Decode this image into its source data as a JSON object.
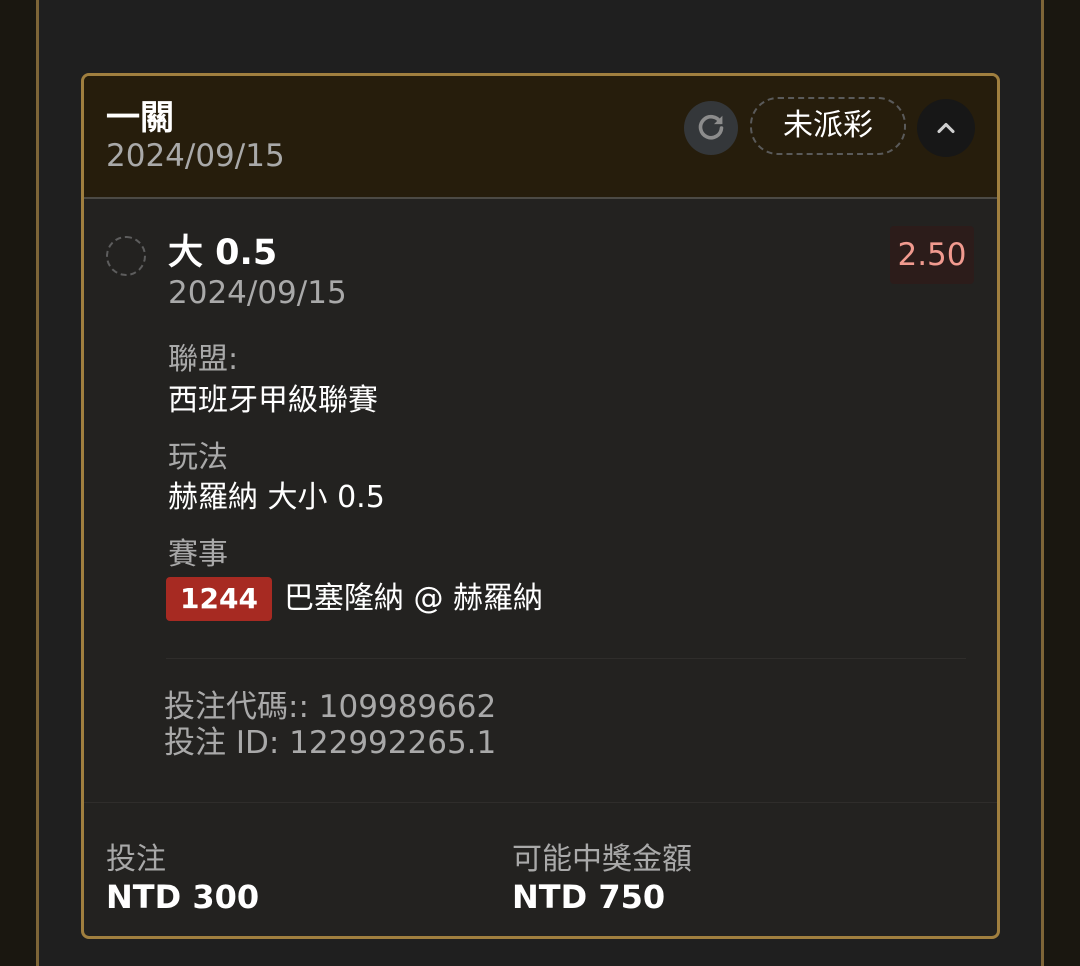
{
  "card": {
    "title": "一關",
    "date": "2024/09/15",
    "status": "未派彩",
    "icons": {
      "refresh": "refresh-icon",
      "collapse": "chevron-up-icon"
    }
  },
  "selection": {
    "title": "大 0.5",
    "date": "2024/09/15",
    "odds": "2.50",
    "league_label": "聯盟:",
    "league_value": "西班牙甲級聯賽",
    "market_label": "玩法",
    "market_value": "赫羅納 大小 0.5",
    "event_label": "賽事",
    "event_id": "1244",
    "event_name": "巴塞隆納 @ 赫羅納"
  },
  "bet_info": {
    "code_line": "投注代碼:: 109989662",
    "id_line": "投注 ID: 122992265.1"
  },
  "footer": {
    "stake_label": "投注",
    "stake_value": "NTD 300",
    "payout_label": "可能中獎金額",
    "payout_value": "NTD 750"
  },
  "colors": {
    "accent_border": "#a07f3f",
    "header_bg": "#261d0c",
    "odds_text": "#f19a8f",
    "event_badge": "#a72a22"
  }
}
